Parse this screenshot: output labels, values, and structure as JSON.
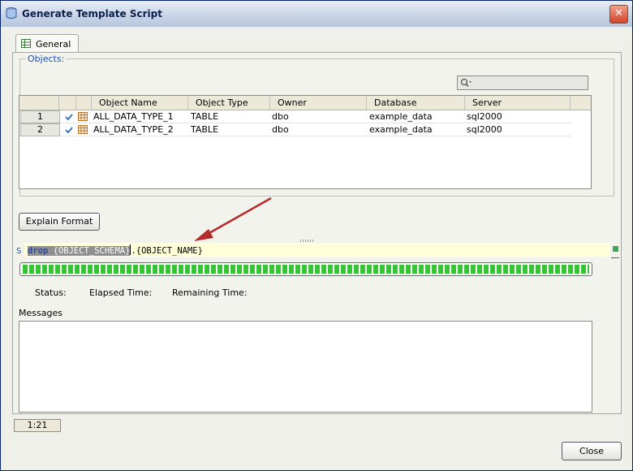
{
  "window": {
    "title": "Generate Template Script",
    "close_glyph": "✕"
  },
  "tabs": [
    {
      "label": "General",
      "icon": "grid-icon"
    }
  ],
  "objects": {
    "legend": "Objects:",
    "columns": [
      "Object Name",
      "Object Type",
      "Owner",
      "Database",
      "Server"
    ],
    "rows": [
      {
        "num": "1",
        "name": "ALL_DATA_TYPE_1",
        "type": "TABLE",
        "owner": "dbo",
        "database": "example_data",
        "server": "sql2000"
      },
      {
        "num": "2",
        "name": "ALL_DATA_TYPE_2",
        "type": "TABLE",
        "owner": "dbo",
        "database": "example_data",
        "server": "sql2000"
      }
    ]
  },
  "buttons": {
    "explain": "Explain Format",
    "close": "Close"
  },
  "script": {
    "selected_prefix": "drop ",
    "selected_kw": "drop",
    "selected_rest": " {OBJECT_SCHEMA}",
    "tail": ".{OBJECT_NAME}",
    "section_letter": "S"
  },
  "progress": {
    "fraction": 1.0
  },
  "status": {
    "status_label": "Status:",
    "elapsed_label": "Elapsed Time:",
    "remaining_label": "Remaining Time:"
  },
  "messages": {
    "label": "Messages"
  },
  "statusbar": {
    "position": "1:21"
  },
  "colors": {
    "accent": "#1b4fb5",
    "progress": "#35c532",
    "arrow": "#b52a2a"
  }
}
